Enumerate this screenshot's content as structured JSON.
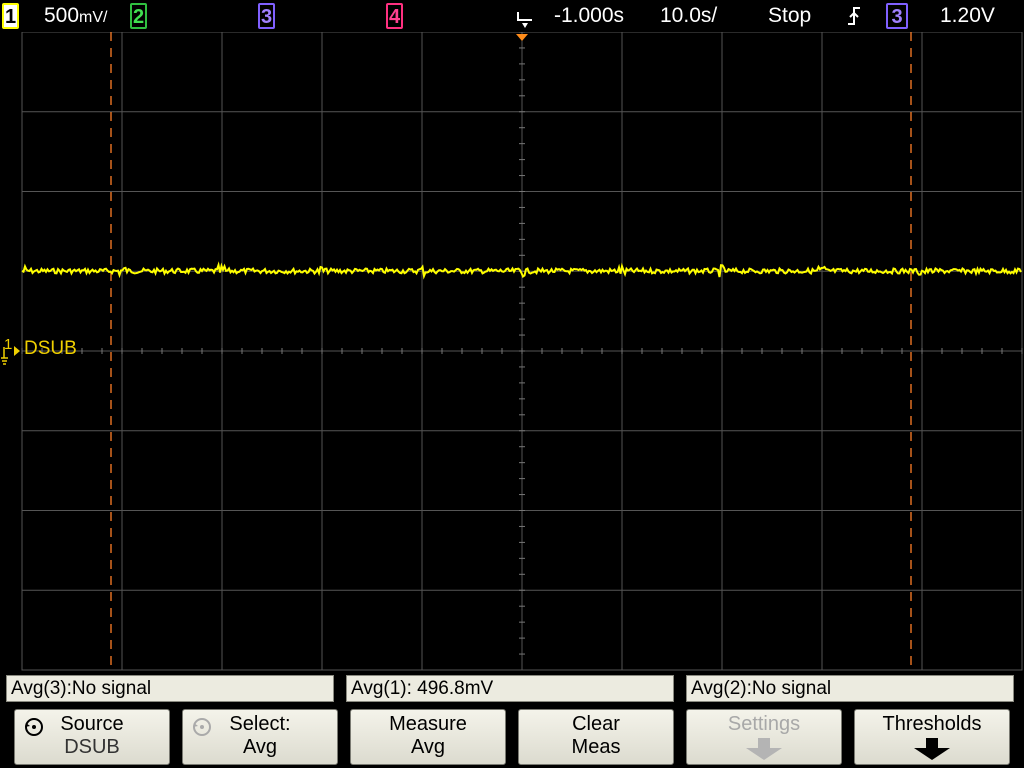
{
  "topbar": {
    "ch1_label": "1",
    "ch1_scale": "500",
    "ch1_scale_unit": "mV/",
    "ch2_label": "2",
    "ch3_label": "3",
    "ch4_label": "4",
    "time_delay": "-1.000s",
    "time_scale": "10.0s/",
    "run_state": "Stop",
    "trigger_slope_icon": "rising-edge-icon",
    "trigger_source": "3",
    "trigger_level": "1.20V"
  },
  "screen": {
    "channel_marker": "1",
    "channel_label": "DSUB",
    "trace_color": "#ffff00",
    "grid_color": "#555555",
    "cursor_color": "#ff7f27"
  },
  "measurements": [
    {
      "text": "Avg(3):No signal"
    },
    {
      "text": "Avg(1): 496.8mV"
    },
    {
      "text": "Avg(2):No signal"
    }
  ],
  "softkeys": [
    {
      "line1": "Source",
      "line2": "DSUB",
      "icon": "rotary-knob-icon",
      "enabled": true
    },
    {
      "line1": "Select:",
      "line2": "Avg",
      "icon": "rotary-knob-icon",
      "enabled": true
    },
    {
      "line1": "Measure",
      "line2": "Avg",
      "enabled": true
    },
    {
      "line1": "Clear",
      "line2": "Meas",
      "enabled": true
    },
    {
      "line1": "Settings",
      "line2": "",
      "icon": "down-arrow-icon",
      "enabled": false
    },
    {
      "line1": "Thresholds",
      "line2": "",
      "icon": "down-arrow-icon",
      "enabled": true
    }
  ]
}
